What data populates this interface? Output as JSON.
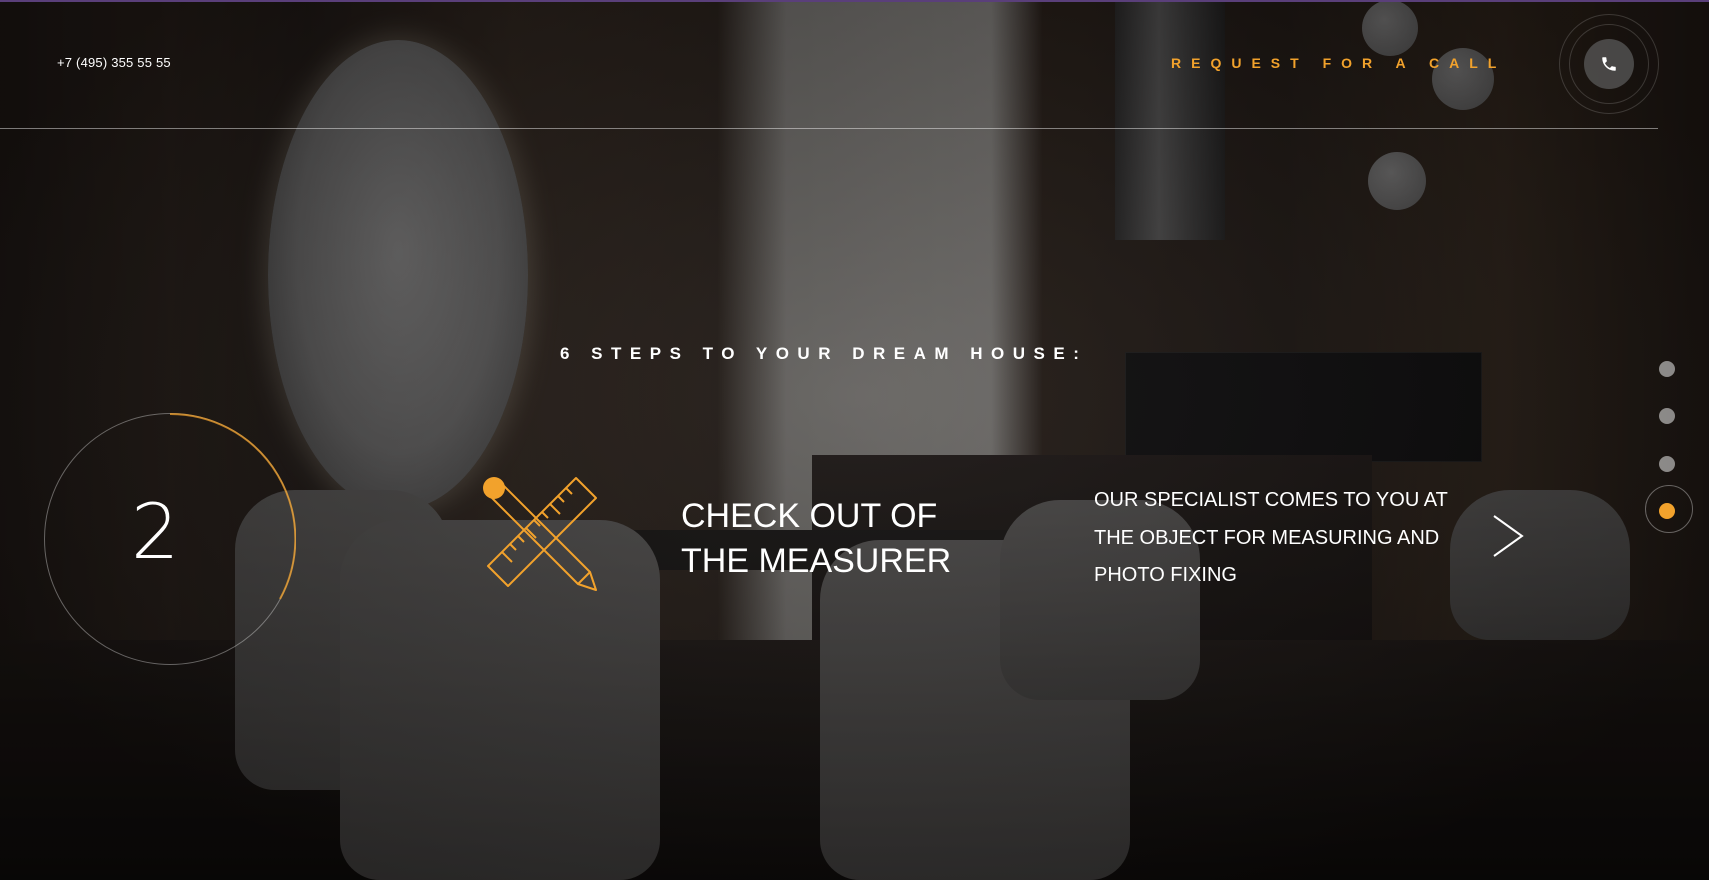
{
  "header": {
    "phone": "+7 (495) 355 55 55",
    "request_label": "REQUEST FOR A CALL",
    "call_icon": "phone-icon"
  },
  "steps": {
    "title": "6 STEPS TO YOUR DREAM HOUSE:",
    "current": {
      "number": "2",
      "icon": "pencil-ruler-icon",
      "title": "CHECK OUT OF THE MEASURER",
      "description": "OUR SPECIALIST COMES TO YOU AT THE OBJECT FOR MEASURING AND PHOTO FIXING"
    },
    "pagination": {
      "count": 4,
      "active_index": 3
    },
    "next_icon": "chevron-right-icon"
  },
  "colors": {
    "accent": "#f2a22c",
    "text": "#ffffff"
  }
}
